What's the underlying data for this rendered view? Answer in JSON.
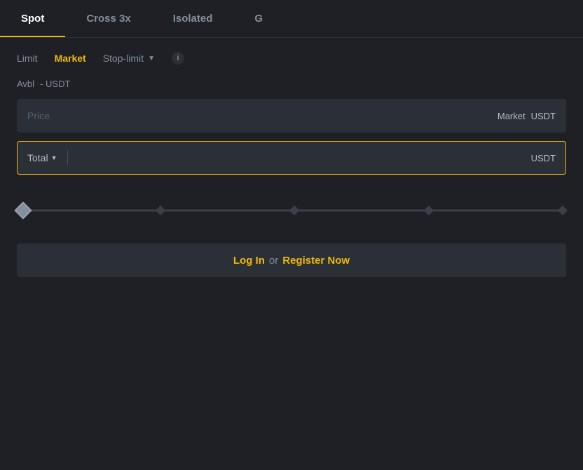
{
  "tabs": [
    {
      "id": "spot",
      "label": "Spot",
      "active": true
    },
    {
      "id": "cross3x",
      "label": "Cross 3x",
      "active": false
    },
    {
      "id": "isolated",
      "label": "Isolated",
      "active": false
    },
    {
      "id": "g",
      "label": "G",
      "active": false
    }
  ],
  "order_types": [
    {
      "id": "limit",
      "label": "Limit",
      "active": false
    },
    {
      "id": "market",
      "label": "Market",
      "active": true
    },
    {
      "id": "stop-limit",
      "label": "Stop-limit",
      "active": false
    }
  ],
  "info_icon": "i",
  "avbl": {
    "label": "Avbl",
    "value": "- USDT"
  },
  "price_input": {
    "placeholder": "Price",
    "market_label": "Market",
    "currency": "USDT"
  },
  "total_input": {
    "label": "Total",
    "currency": "USDT",
    "value": ""
  },
  "slider": {
    "value": 0,
    "marks": [
      "0%",
      "25%",
      "50%",
      "75%",
      "100%"
    ]
  },
  "login_btn": {
    "login_text": "Log In",
    "or_text": "or",
    "register_text": "Register Now"
  },
  "colors": {
    "accent": "#f0b90b",
    "bg_dark": "#1e2026",
    "bg_input": "#2b2f36",
    "text_muted": "#848e9c",
    "text_light": "#b7bdc6",
    "text_white": "#ffffff"
  }
}
